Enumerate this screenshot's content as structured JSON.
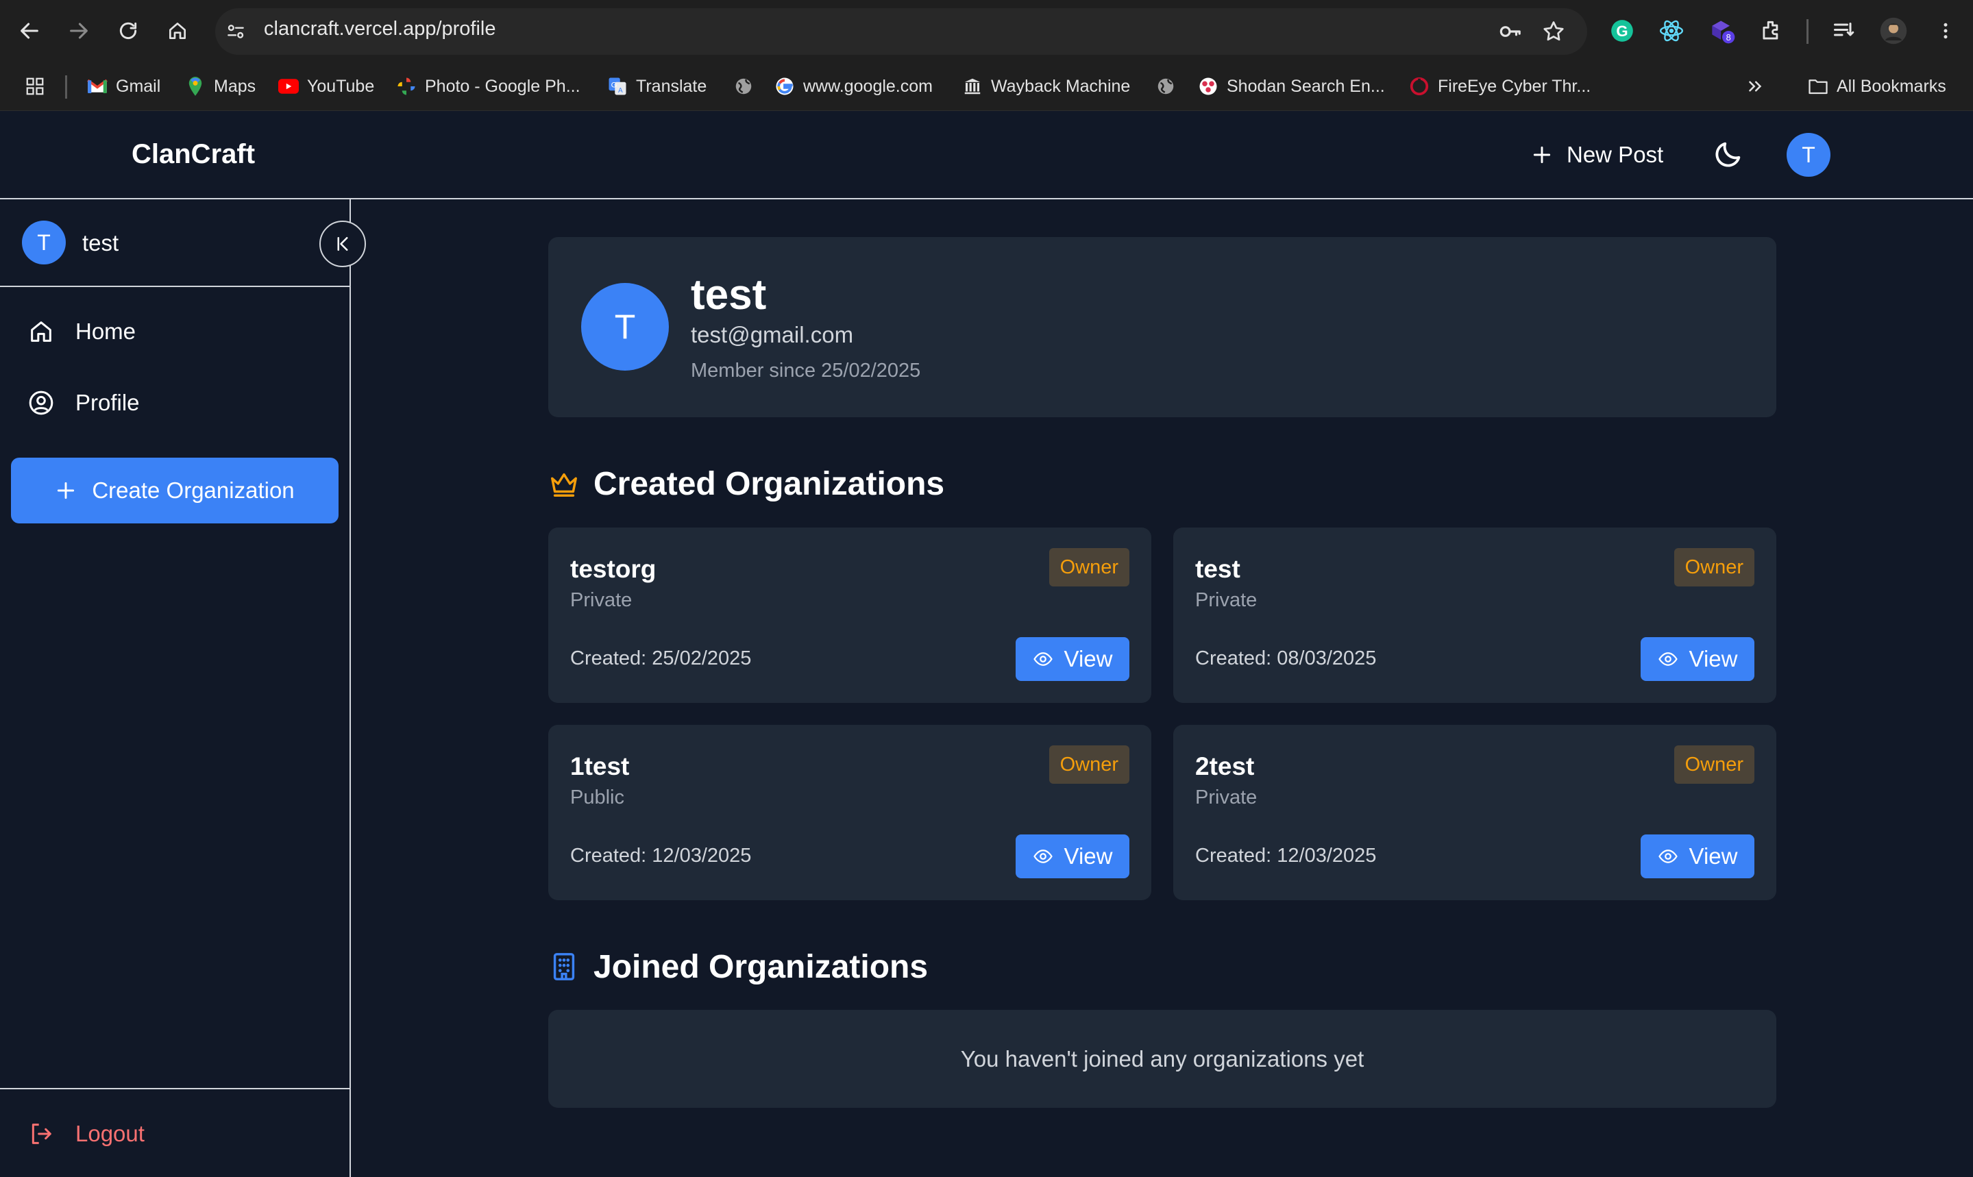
{
  "browser": {
    "url": "clancraft.vercel.app/profile",
    "bookmarks": [
      {
        "label": "Gmail"
      },
      {
        "label": "Maps"
      },
      {
        "label": "YouTube"
      },
      {
        "label": "Photo - Google Ph..."
      },
      {
        "label": "Translate"
      },
      {
        "label": "www.google.com"
      },
      {
        "label": "Wayback Machine"
      },
      {
        "label": "Shodan Search En..."
      },
      {
        "label": "FireEye Cyber Thr..."
      }
    ],
    "all_bookmarks": "All Bookmarks",
    "extension_badge": "8"
  },
  "header": {
    "brand": "ClanCraft",
    "new_post": "New Post",
    "avatar_initial": "T"
  },
  "sidebar": {
    "avatar_initial": "T",
    "username": "test",
    "nav": [
      {
        "label": "Home",
        "icon": "home-icon"
      },
      {
        "label": "Profile",
        "icon": "user-circle-icon"
      }
    ],
    "create_org": "Create Organization",
    "logout": "Logout"
  },
  "profile": {
    "avatar_initial": "T",
    "name": "test",
    "email": "test@gmail.com",
    "member_since": "Member since 25/02/2025"
  },
  "created_section": {
    "title": "Created Organizations",
    "orgs": [
      {
        "name": "testorg",
        "visibility": "Private",
        "role": "Owner",
        "created": "Created: 25/02/2025",
        "action": "View"
      },
      {
        "name": "test",
        "visibility": "Private",
        "role": "Owner",
        "created": "Created: 08/03/2025",
        "action": "View"
      },
      {
        "name": "1test",
        "visibility": "Public",
        "role": "Owner",
        "created": "Created: 12/03/2025",
        "action": "View"
      },
      {
        "name": "2test",
        "visibility": "Private",
        "role": "Owner",
        "created": "Created: 12/03/2025",
        "action": "View"
      }
    ]
  },
  "joined_section": {
    "title": "Joined Organizations",
    "empty_message": "You haven't joined any organizations yet"
  },
  "colors": {
    "background": "#111827",
    "card": "#1f2937",
    "accent": "#3b82f6",
    "owner_text": "#f59e0b",
    "logout": "#f87171"
  }
}
